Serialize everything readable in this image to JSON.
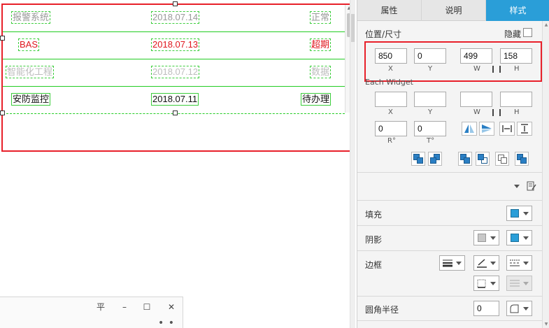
{
  "list": {
    "rows": [
      {
        "name": "报警系统",
        "date": "2018.07.14",
        "status": "正常",
        "name_color": "#9a9a9a",
        "date_color": "#9a9a9a",
        "status_color": "#9a9a9a"
      },
      {
        "name": "BAS",
        "date": "2018.07.13",
        "status": "超期",
        "name_color": "#e0161e",
        "date_color": "#e0161e",
        "status_color": "#e0161e"
      },
      {
        "name": "智能化工程",
        "date": "2018.07.12",
        "status": "数据",
        "name_color": "#bdbdbd",
        "date_color": "#bdbdbd",
        "status_color": "#bdbdbd"
      },
      {
        "name": "安防监控",
        "date": "2018.07.11",
        "status": "待办理",
        "name_color": "#111111",
        "date_color": "#111111",
        "status_color": "#111111"
      }
    ]
  },
  "mini_window": {
    "pin": "平",
    "minimize": "–",
    "maximize": "☐",
    "close": "✕",
    "more": "• • •"
  },
  "panel": {
    "tabs": [
      {
        "label": "属性"
      },
      {
        "label": "说明"
      },
      {
        "label": "样式"
      }
    ],
    "position": {
      "title": "位置/尺寸",
      "hide_label": "隐藏",
      "x": "850",
      "y": "0",
      "w": "499",
      "h": "158",
      "x_label": "X",
      "y_label": "Y",
      "w_label": "W",
      "h_label": "H"
    },
    "each_widget": {
      "title": "Each Widget",
      "x": "",
      "y": "",
      "w": "",
      "h": "",
      "x_label": "X",
      "y_label": "Y",
      "w_label": "W",
      "h_label": "H"
    },
    "rotation": {
      "r": "0",
      "t": "0",
      "r_label": "R°",
      "t_label": "T°"
    },
    "fill_label": "填充",
    "shadow_label": "阴影",
    "border_label": "边框",
    "radius_label": "圆角半径",
    "radius_value": "0",
    "accent_color": "#2a9ed8",
    "highlight_color": "#e8202a"
  }
}
